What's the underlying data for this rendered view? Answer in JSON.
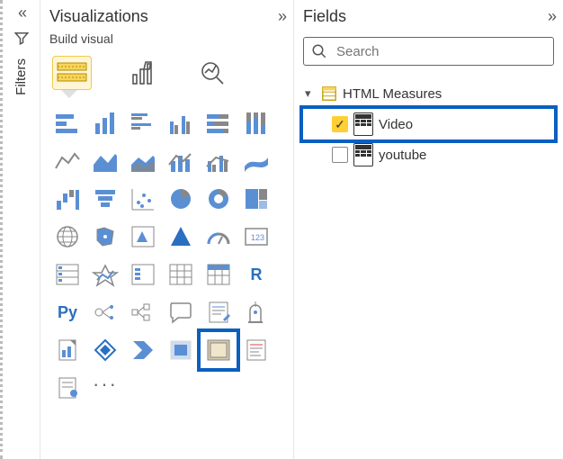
{
  "left_rail": {
    "filters_label": "Filters"
  },
  "viz_panel": {
    "title": "Visualizations",
    "sub": "Build visual",
    "tabs": {
      "build": "build-visual-tab",
      "format": "format-tab",
      "analytics": "analytics-tab"
    },
    "cells": [
      {
        "name": "stacked-bar-chart-icon"
      },
      {
        "name": "stacked-column-chart-icon"
      },
      {
        "name": "clustered-bar-chart-icon"
      },
      {
        "name": "clustered-column-chart-icon"
      },
      {
        "name": "hundred-stacked-bar-icon"
      },
      {
        "name": "hundred-stacked-column-icon"
      },
      {
        "name": "line-chart-icon"
      },
      {
        "name": "area-chart-icon"
      },
      {
        "name": "stacked-area-chart-icon"
      },
      {
        "name": "line-stacked-column-icon"
      },
      {
        "name": "line-clustered-column-icon"
      },
      {
        "name": "ribbon-chart-icon"
      },
      {
        "name": "waterfall-chart-icon"
      },
      {
        "name": "funnel-chart-icon"
      },
      {
        "name": "scatter-chart-icon"
      },
      {
        "name": "pie-chart-icon"
      },
      {
        "name": "donut-chart-icon"
      },
      {
        "name": "treemap-icon"
      },
      {
        "name": "map-icon"
      },
      {
        "name": "filled-map-icon"
      },
      {
        "name": "azure-map-icon"
      },
      {
        "name": "arcgis-map-icon"
      },
      {
        "name": "gauge-icon"
      },
      {
        "name": "card-icon"
      },
      {
        "name": "multi-row-card-icon"
      },
      {
        "name": "kpi-icon"
      },
      {
        "name": "slicer-icon"
      },
      {
        "name": "table-icon"
      },
      {
        "name": "matrix-icon"
      },
      {
        "name": "r-visual-icon",
        "letter": "R"
      },
      {
        "name": "python-visual-icon",
        "letter": "Py"
      },
      {
        "name": "key-influencers-icon"
      },
      {
        "name": "decomposition-tree-icon"
      },
      {
        "name": "qa-visual-icon"
      },
      {
        "name": "smart-narrative-icon"
      },
      {
        "name": "goals-icon"
      },
      {
        "name": "paginated-report-icon"
      },
      {
        "name": "power-apps-icon"
      },
      {
        "name": "power-automate-icon"
      },
      {
        "name": "custom-visual-1-icon"
      },
      {
        "name": "html-content-visual-icon",
        "selected": true
      },
      {
        "name": "custom-visual-2-icon"
      },
      {
        "name": "custom-visual-3-icon"
      },
      {
        "name": "get-more-visuals-icon",
        "dots": true
      }
    ]
  },
  "fields_panel": {
    "title": "Fields",
    "search_placeholder": "Search",
    "tables": [
      {
        "name": "HTML Measures",
        "expanded": true,
        "fields": [
          {
            "name": "Video",
            "checked": true,
            "highlighted": true
          },
          {
            "name": "youtube",
            "checked": false,
            "highlighted": false
          }
        ]
      }
    ]
  }
}
